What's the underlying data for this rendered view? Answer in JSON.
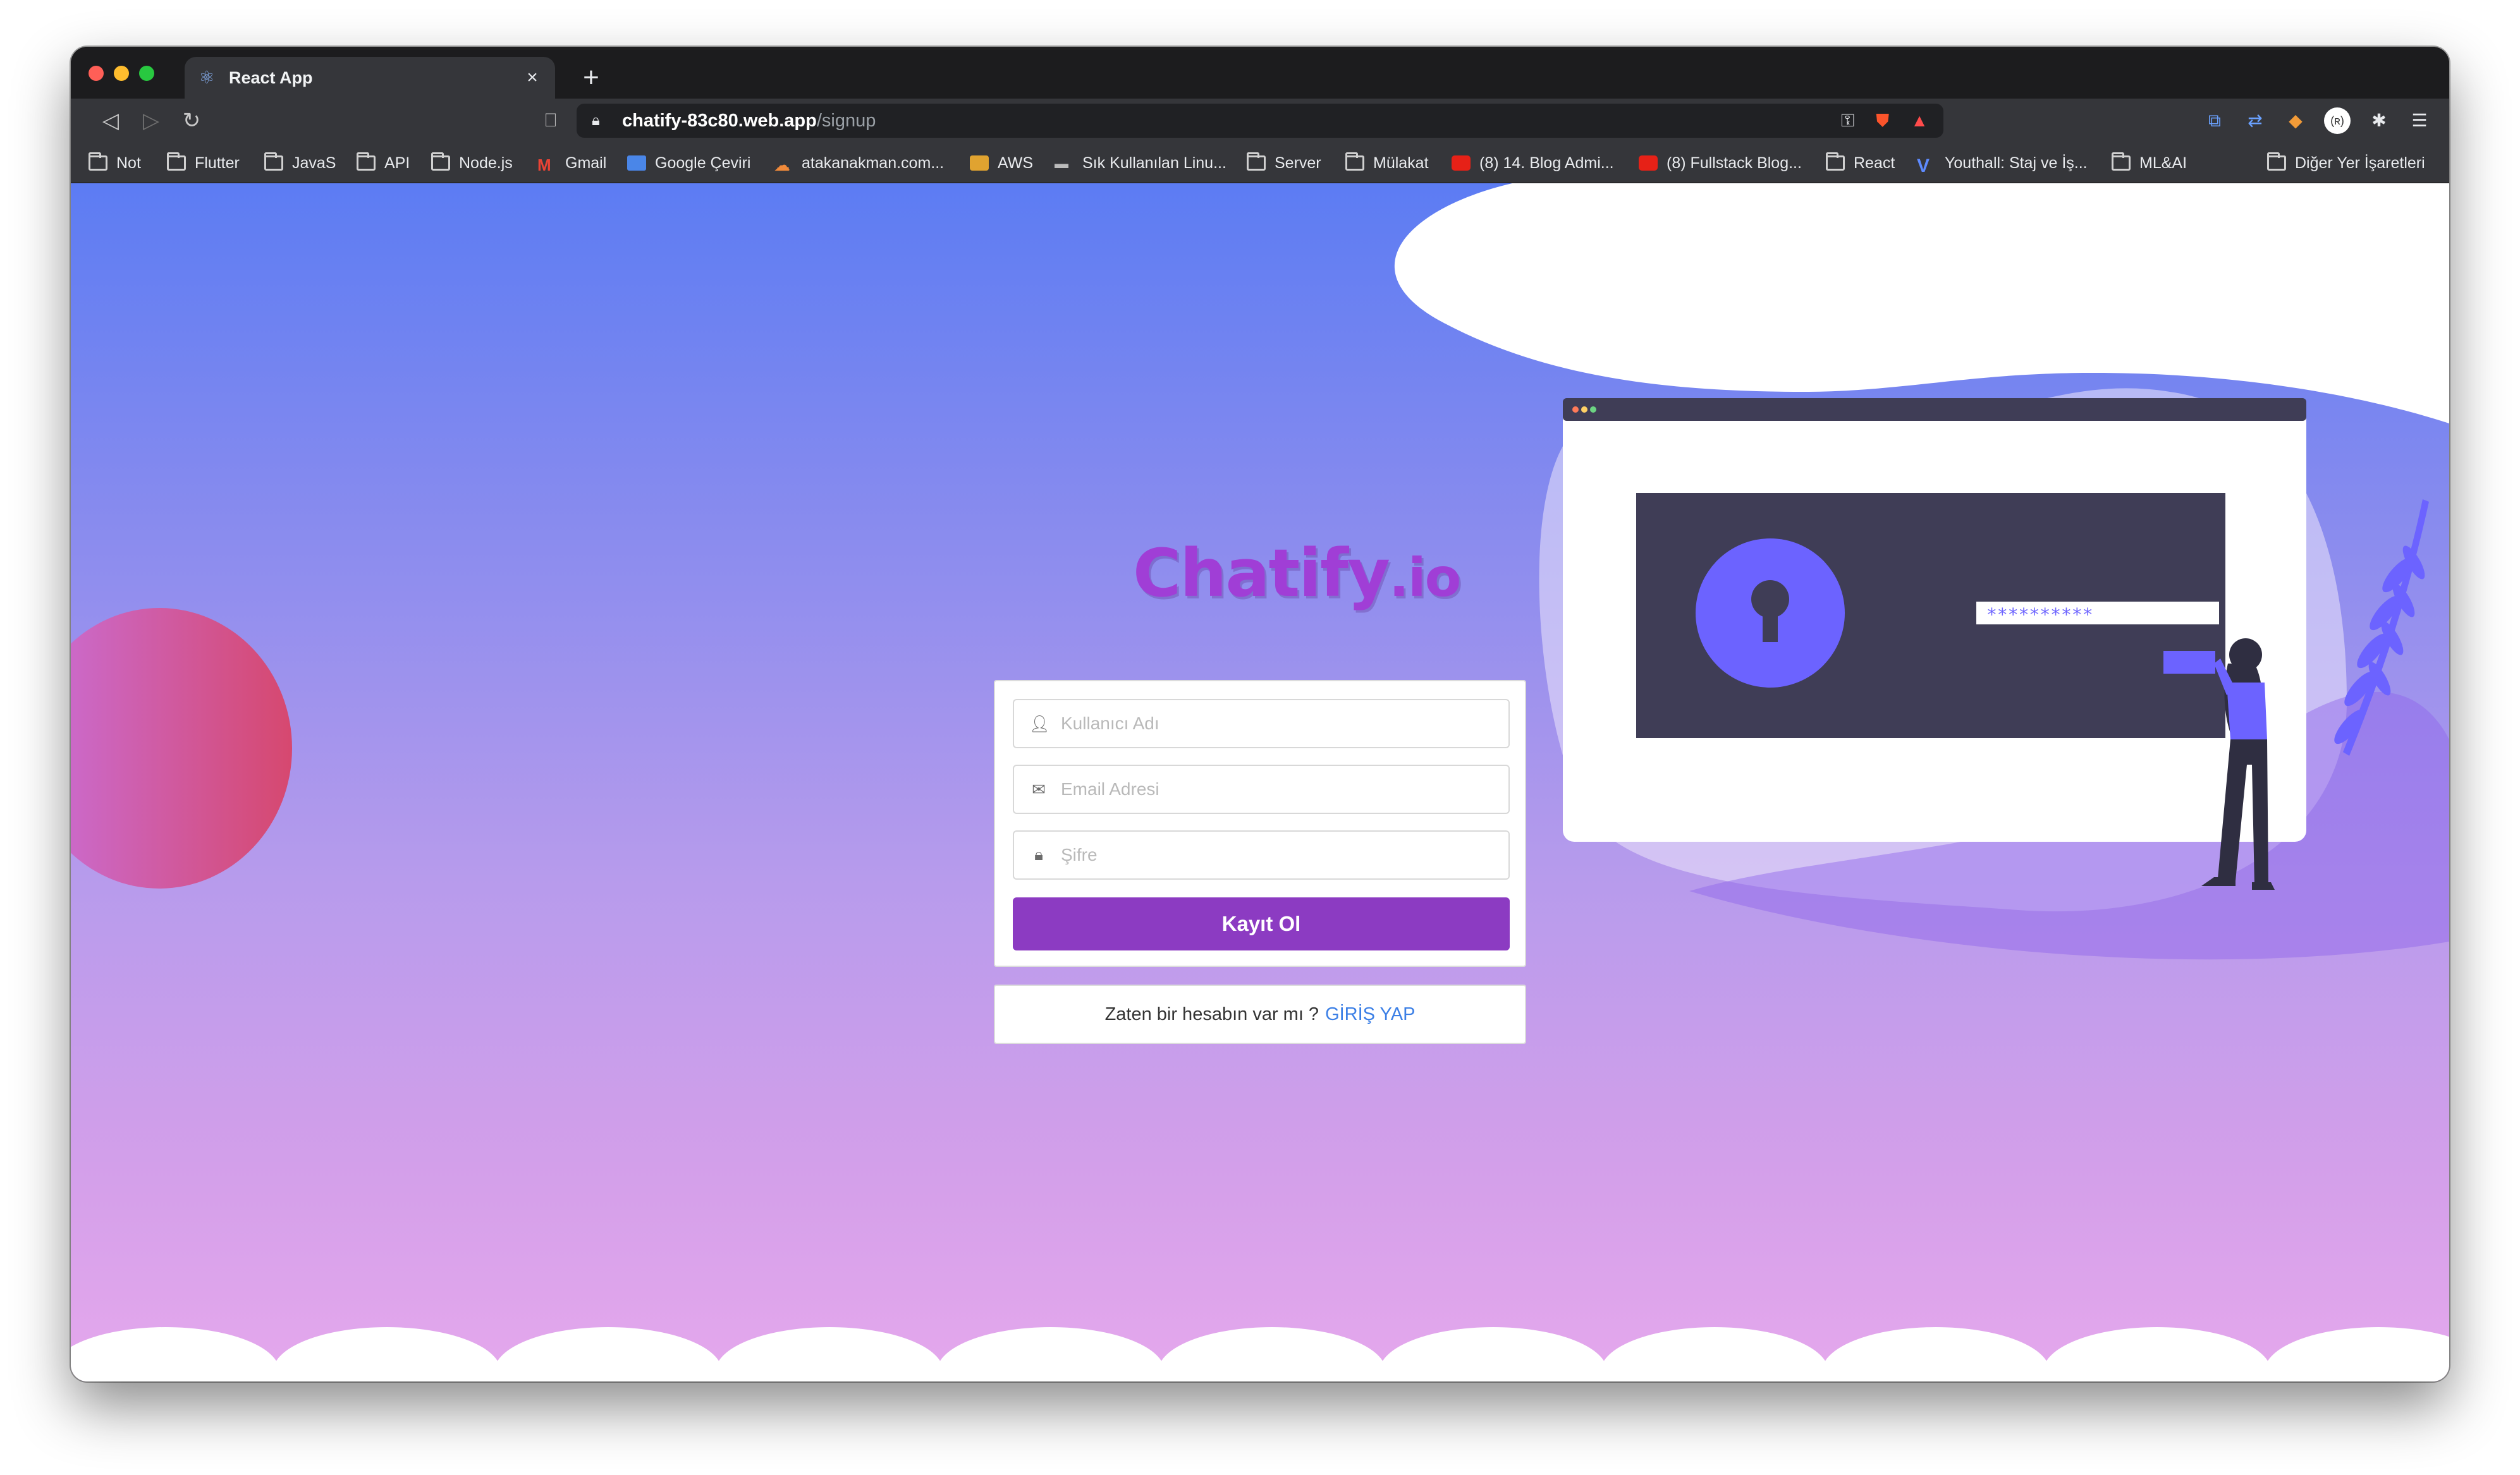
{
  "browser": {
    "tab_title": "React App",
    "new_tab_label": "+",
    "tab_close_label": "×",
    "url_host": "chatify-83c80.web.app",
    "url_path": "/signup"
  },
  "bookmarks": [
    {
      "label": "Not",
      "icon": "folder-icon"
    },
    {
      "label": "Flutter",
      "icon": "folder-icon"
    },
    {
      "label": "JavaS",
      "icon": "folder-icon"
    },
    {
      "label": "API",
      "icon": "folder-icon"
    },
    {
      "label": "Node.js",
      "icon": "folder-icon"
    },
    {
      "label": "Gmail",
      "icon": "gmail-icon"
    },
    {
      "label": "Google Çeviri",
      "icon": "translate-icon"
    },
    {
      "label": "atakanakman.com...",
      "icon": "cloud-icon"
    },
    {
      "label": "AWS",
      "icon": "box-icon"
    },
    {
      "label": "Sık Kullanılan Linu...",
      "icon": "terminal-icon"
    },
    {
      "label": "Server",
      "icon": "folder-icon"
    },
    {
      "label": "Mülakat",
      "icon": "folder-icon"
    },
    {
      "label": "(8) 14. Blog Admi...",
      "icon": "youtube-icon"
    },
    {
      "label": "(8) Fullstack Blog...",
      "icon": "youtube-icon"
    },
    {
      "label": "React",
      "icon": "folder-icon"
    },
    {
      "label": "Youthall: Staj ve İş...",
      "icon": "youthall-icon"
    },
    {
      "label": "ML&AI",
      "icon": "folder-icon"
    },
    {
      "label": "Diğer Yer İşaretleri",
      "icon": "folder-icon"
    }
  ],
  "page": {
    "logo_main": "Chatify",
    "logo_suffix": ".io",
    "username_placeholder": "Kullanıcı Adı",
    "email_placeholder": "Email Adresi",
    "password_placeholder": "Şifre",
    "submit_label": "Kayıt Ol",
    "login_prompt": "Zaten bir hesabın var mı ?",
    "login_link": "GİRİŞ YAP",
    "password_mask": "**********"
  },
  "colors": {
    "brand_purple": "#a03ed6",
    "button_purple": "#8c3bc2",
    "link_blue": "#3b7fe6",
    "illustration_accent": "#6c63ff"
  }
}
